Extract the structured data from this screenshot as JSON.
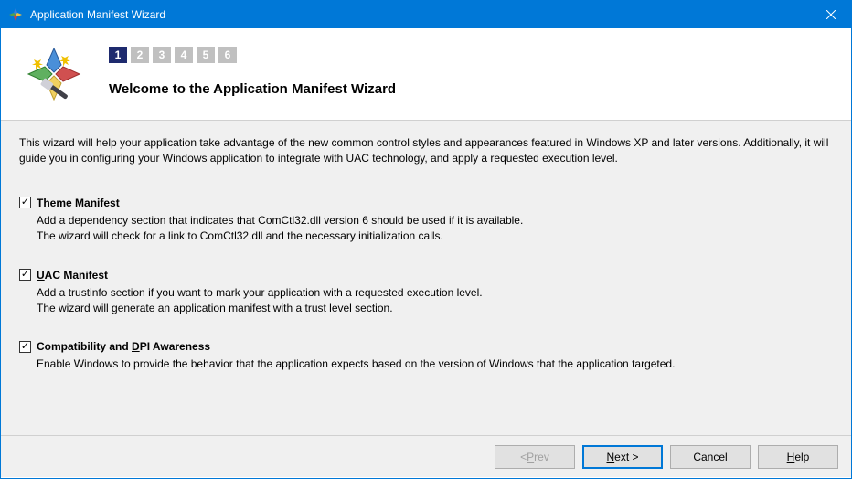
{
  "titlebar": {
    "title": "Application Manifest Wizard"
  },
  "header": {
    "steps": [
      "1",
      "2",
      "3",
      "4",
      "5",
      "6"
    ],
    "active_step": 0,
    "welcome_title": "Welcome to the Application Manifest Wizard"
  },
  "intro": "This wizard will help your application take advantage of the new common control styles and appearances featured in Windows XP and later versions. Additionally, it will guide you in configuring your Windows application to integrate with UAC technology, and apply a requested execution level.",
  "options": [
    {
      "checked": true,
      "label_pre": "",
      "label_u": "T",
      "label_post": "heme Manifest",
      "desc": "Add a dependency section that indicates that ComCtl32.dll version 6 should be used if it is available.\nThe wizard will check for a link to ComCtl32.dll and the necessary initialization calls."
    },
    {
      "checked": true,
      "label_pre": "",
      "label_u": "U",
      "label_post": "AC Manifest",
      "desc": "Add a trustinfo section if you want to mark your application with a requested execution level.\nThe wizard will generate an application manifest with a trust level section."
    },
    {
      "checked": true,
      "label_pre": "Compatibility and ",
      "label_u": "D",
      "label_post": "PI Awareness",
      "desc": "Enable Windows to provide the behavior that the application expects based on the version of Windows that the application targeted."
    }
  ],
  "buttons": {
    "prev_pre": "< ",
    "prev_u": "P",
    "prev_post": "rev",
    "next_pre": "",
    "next_u": "N",
    "next_post": "ext >",
    "cancel": "Cancel",
    "help_u": "H",
    "help_post": "elp"
  }
}
